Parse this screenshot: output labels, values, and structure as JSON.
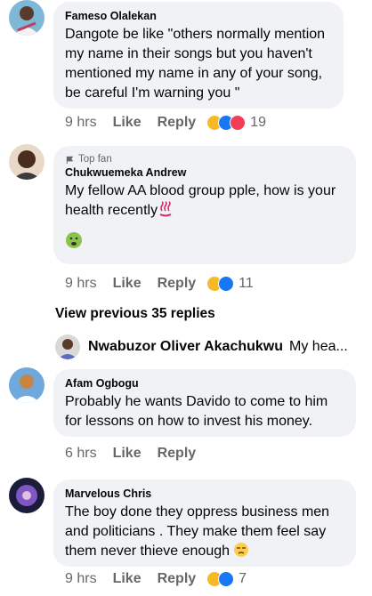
{
  "comments": [
    {
      "author": "Fameso Olalekan",
      "text": "Dangote be like \"others normally mention my name in their songs but you haven't mentioned my name in any of your song, be careful I'm warning you \"",
      "time": "9 hrs",
      "like": "Like",
      "reply": "Reply",
      "reaction_count": "19",
      "reactions": [
        "laugh",
        "like",
        "love"
      ]
    },
    {
      "badge": "Top fan",
      "author": "Chukwuemeka Andrew",
      "text": "My fellow AA blood group pple, how is your health recently",
      "emoji_inline": "hot-springs",
      "sticker": "sick-face",
      "time": "9 hrs",
      "like": "Like",
      "reply": "Reply",
      "reaction_count": "11",
      "reactions": [
        "laugh",
        "like"
      ]
    },
    {
      "author": "Afam Ogbogu",
      "text": "Probably he wants Davido to come to him for lessons on how to invest his money.",
      "time": "6 hrs",
      "like": "Like",
      "reply": "Reply"
    },
    {
      "author": "Marvelous Chris",
      "text": "The boy done they oppress business men and politicians . They make them feel say them never thieve enough",
      "emoji_inline": "unamused-face",
      "time": "9 hrs",
      "like": "Like",
      "reply": "Reply",
      "reaction_count": "7",
      "reactions": [
        "laugh",
        "like"
      ]
    }
  ],
  "view_previous": "View previous 35 replies",
  "reply_preview": {
    "author": "Nwabuzor Oliver Akachukwu",
    "text": "My hea..."
  },
  "colors": {
    "bubble": "#f0f2f5",
    "meta": "#65676b",
    "like_blue": "#1877f2",
    "love_red": "#f33e58",
    "haha_yellow": "#f7b928"
  }
}
